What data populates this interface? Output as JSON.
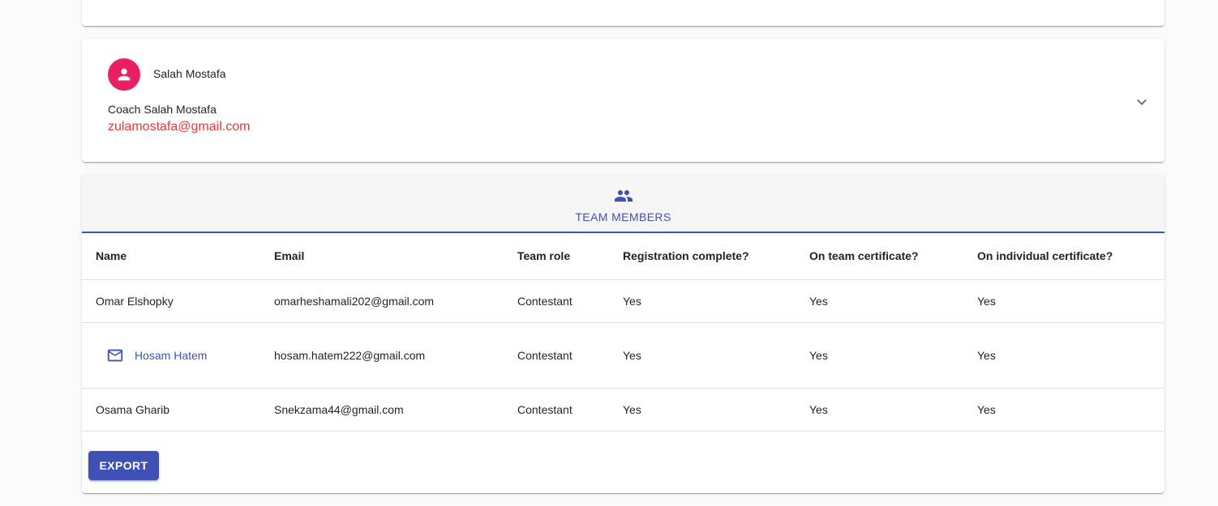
{
  "coach": {
    "name": "Salah Mostafa",
    "title": "Coach Salah Mostafa",
    "email": "zulamostafa@gmail.com",
    "avatar_icon": "person-icon",
    "avatar_color": "#e91e63",
    "expand_icon": "chevron-down-icon"
  },
  "team_tab": {
    "label": "Team Members",
    "icon": "group-icon",
    "accent": "#3f51b5"
  },
  "table": {
    "headers": [
      "Name",
      "Email",
      "Team role",
      "Registration complete?",
      "On team certificate?",
      "On individual certificate?"
    ],
    "rows": [
      {
        "name": "Omar Elshopky",
        "email": "omarheshamali202@gmail.com",
        "role": "Contestant",
        "registration": "Yes",
        "team_cert": "Yes",
        "individual_cert": "Yes"
      },
      {
        "name": "Hosam Hatem",
        "name_icon": "mail-icon",
        "email": "hosam.hatem222@gmail.com",
        "role": "Contestant",
        "registration": "Yes",
        "team_cert": "Yes",
        "individual_cert": "Yes"
      },
      {
        "name": "Osama Gharib",
        "email": "Snekzama44@gmail.com",
        "role": "Contestant",
        "registration": "Yes",
        "team_cert": "Yes",
        "individual_cert": "Yes"
      }
    ]
  },
  "actions": {
    "export_label": "Export"
  }
}
